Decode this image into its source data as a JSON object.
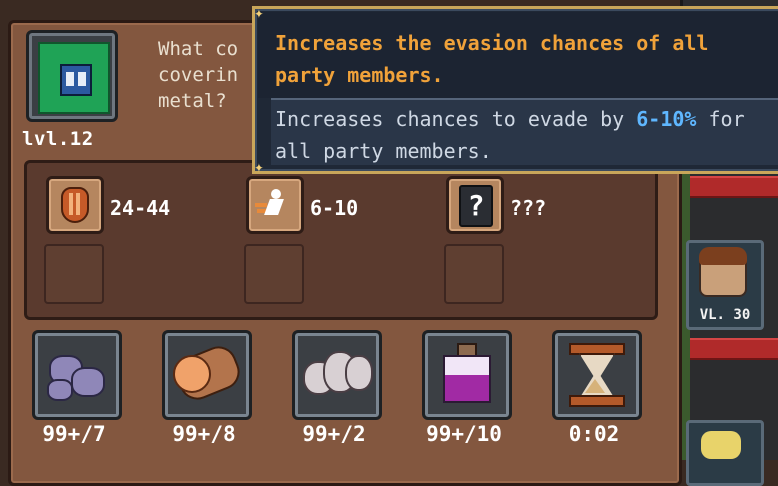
{
  "item": {
    "icon": "armor-rune-icon",
    "level": "lvl.12",
    "description": "What co\ncoverin\nmetal?"
  },
  "stats": [
    {
      "icon": "shield-icon",
      "value": "24-44"
    },
    {
      "icon": "runner-evade-icon",
      "value": "6-10"
    },
    {
      "icon": "question-mark-icon",
      "value": "???"
    }
  ],
  "materials": [
    {
      "icon": "purple-ore-icon",
      "count": "99+/7"
    },
    {
      "icon": "wood-log-icon",
      "count": "99+/8"
    },
    {
      "icon": "cloth-icon",
      "count": "99+/2"
    },
    {
      "icon": "purple-potion-icon",
      "count": "99+/10"
    },
    {
      "icon": "hourglass-icon",
      "count": "0:02"
    }
  ],
  "tooltip": {
    "title": "Increases the evasion chances of all\nparty members.",
    "body_prefix": "Increases chances to evade by ",
    "body_highlight": "6-10%",
    "body_suffix": " for\nall party members."
  },
  "party": {
    "hero_level": "VL. 30"
  },
  "colors": {
    "panel": "#83573f",
    "tooltip_bg": "#1f2836",
    "tooltip_title": "#f0a23a",
    "highlight": "#5fb7ff"
  }
}
